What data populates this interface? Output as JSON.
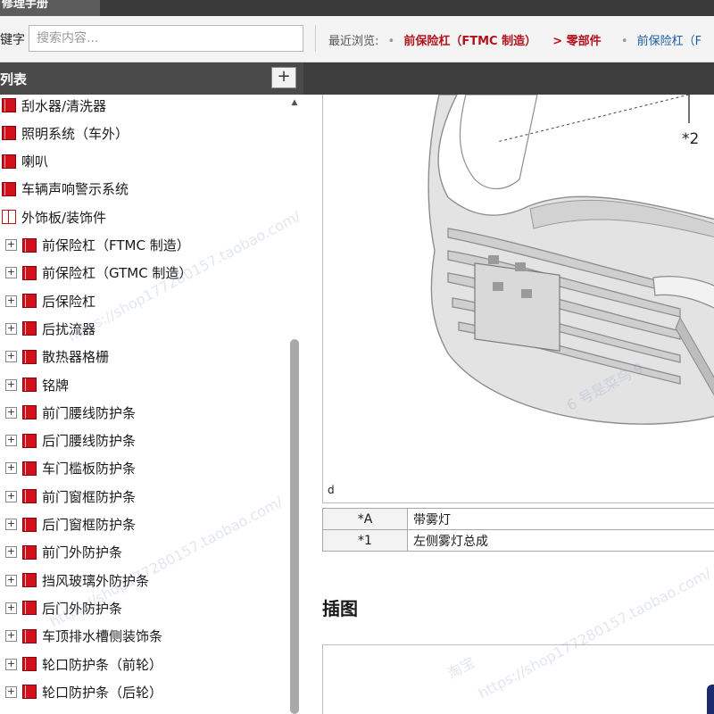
{
  "header": {
    "app_title": "修理手册"
  },
  "search": {
    "label": "键字",
    "placeholder": "搜索内容..."
  },
  "recent": {
    "label": "最近浏览:",
    "items": [
      "前保险杠（FTMC 制造）",
      "> 零部件",
      "前保险杠（F"
    ]
  },
  "sidebar": {
    "title": "列表",
    "add_label": "+",
    "items": [
      {
        "label": "刮水器/清洗器",
        "expandable": false,
        "icon": "book-icon"
      },
      {
        "label": "照明系统（车外）",
        "expandable": false,
        "icon": "book-icon"
      },
      {
        "label": "喇叭",
        "expandable": false,
        "icon": "book-icon"
      },
      {
        "label": "车辆声响警示系统",
        "expandable": false,
        "icon": "book-icon"
      },
      {
        "label": "外饰板/装饰件",
        "expandable": false,
        "icon": "open-book-icon"
      },
      {
        "label": "前保险杠（FTMC 制造）",
        "expandable": true,
        "icon": "book-icon"
      },
      {
        "label": "前保险杠（GTMC 制造）",
        "expandable": true,
        "icon": "book-icon"
      },
      {
        "label": "后保险杠",
        "expandable": true,
        "icon": "book-icon"
      },
      {
        "label": "后扰流器",
        "expandable": true,
        "icon": "book-icon"
      },
      {
        "label": "散热器格栅",
        "expandable": true,
        "icon": "book-icon"
      },
      {
        "label": "铭牌",
        "expandable": true,
        "icon": "book-icon"
      },
      {
        "label": "前门腰线防护条",
        "expandable": true,
        "icon": "book-icon"
      },
      {
        "label": "后门腰线防护条",
        "expandable": true,
        "icon": "book-icon"
      },
      {
        "label": "车门槛板防护条",
        "expandable": true,
        "icon": "book-icon"
      },
      {
        "label": "前门窗框防护条",
        "expandable": true,
        "icon": "book-icon"
      },
      {
        "label": "后门窗框防护条",
        "expandable": true,
        "icon": "book-icon"
      },
      {
        "label": "前门外防护条",
        "expandable": true,
        "icon": "book-icon"
      },
      {
        "label": "挡风玻璃外防护条",
        "expandable": true,
        "icon": "book-icon"
      },
      {
        "label": "后门外防护条",
        "expandable": true,
        "icon": "book-icon"
      },
      {
        "label": "车顶排水槽侧装饰条",
        "expandable": true,
        "icon": "book-icon"
      },
      {
        "label": "轮口防护条（前轮）",
        "expandable": true,
        "icon": "book-icon"
      },
      {
        "label": "轮口防护条（后轮）",
        "expandable": true,
        "icon": "book-icon"
      }
    ]
  },
  "main": {
    "figure": {
      "callout": "*2",
      "corner_label": "d"
    },
    "legend": [
      {
        "key": "*A",
        "value": "带雾灯"
      },
      {
        "key": "*1",
        "value": "左侧雾灯总成"
      }
    ],
    "section_title": "插图"
  },
  "watermarks": [
    "https://shop177280157.taobao.com/",
    "淘宝",
    "6 号是菜鸟 9"
  ],
  "colors": {
    "accent_red": "#b3121b",
    "link_blue": "#1a5ea8",
    "header_dark": "#4a4a4a"
  }
}
